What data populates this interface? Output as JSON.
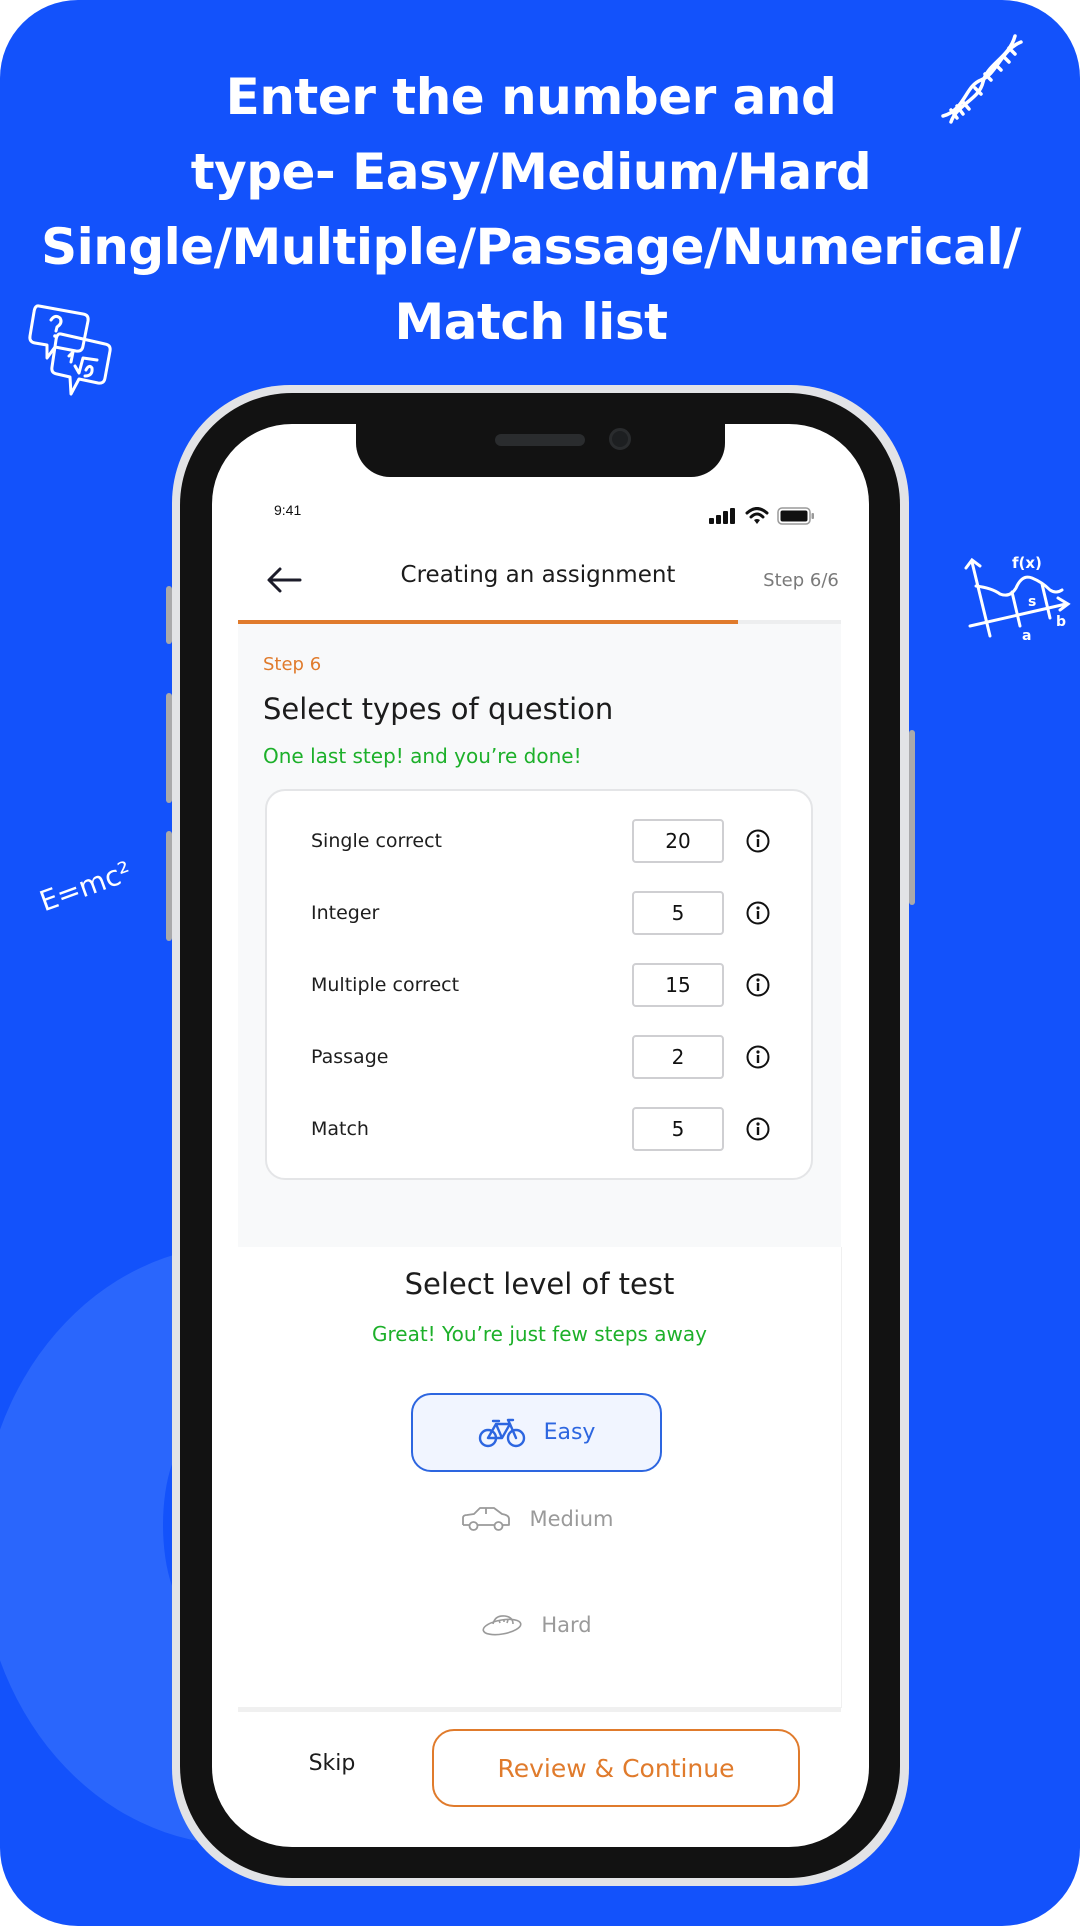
{
  "promo": {
    "headline_lines": [
      "Enter the number and",
      "type- Easy/Medium/Hard",
      "Single/Multiple/Passage/Numerical/",
      "Match list"
    ],
    "background_color": "#1352FB",
    "decorations": [
      "dna-icon",
      "question-bubbles-icon",
      "function-graph-icon",
      "emc2-formula"
    ],
    "emc2_text": "E=mc²"
  },
  "status_bar": {
    "time": "9:41",
    "icons": [
      "signal-icon",
      "wifi-icon",
      "battery-icon"
    ]
  },
  "nav": {
    "back_icon": "arrow-left-icon",
    "title": "Creating an assignment",
    "step_indicator": "Step 6/6",
    "progress": 0.83,
    "accent_color": "#E07B2C"
  },
  "question_types": {
    "step_label": "Step 6",
    "title": "Select types of question",
    "subtitle": "One last step! and you’re done!",
    "items": [
      {
        "label": "Single correct",
        "value": "20"
      },
      {
        "label": "Integer",
        "value": "5"
      },
      {
        "label": "Multiple correct",
        "value": "15"
      },
      {
        "label": "Passage",
        "value": "2"
      },
      {
        "label": "Match",
        "value": "5"
      }
    ],
    "info_icon": "info-circle-icon"
  },
  "level": {
    "title": "Select level of test",
    "subtitle": "Great! You’re just few steps away",
    "options": [
      {
        "label": "Easy",
        "icon": "bicycle-icon",
        "selected": true
      },
      {
        "label": "Medium",
        "icon": "car-icon",
        "selected": false
      },
      {
        "label": "Hard",
        "icon": "ufo-icon",
        "selected": false
      }
    ],
    "selected_color": "#2D66E0"
  },
  "footer": {
    "skip_label": "Skip",
    "continue_label": "Review & Continue"
  }
}
